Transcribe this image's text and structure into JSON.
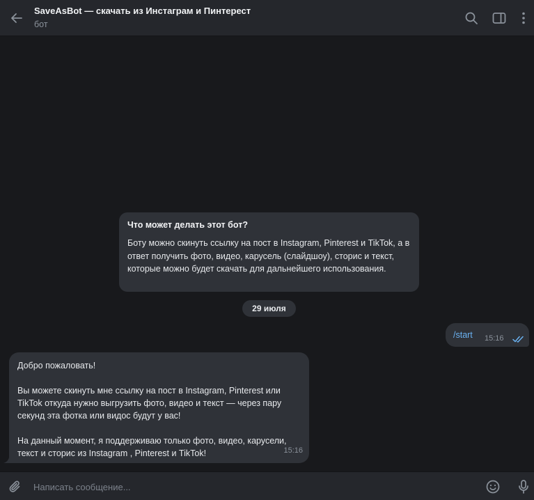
{
  "header": {
    "title": "SaveAsBot — скачать из Инстаграм и Пинтерест",
    "subtitle": "бот",
    "icons": [
      "back-arrow-icon",
      "search-icon",
      "sidebar-toggle-icon",
      "more-vertical-icon"
    ]
  },
  "intro_card": {
    "title": "Что может делать этот бот?",
    "text": "Боту можно скинуть ссылку на пост в Instagram, Pinterest и TikTok, а в ответ получить фото, видео, карусель (слайдшоу), сторис и текст, которые можно будет скачать для дальнейшего использования."
  },
  "date_separator": "29 июля",
  "outgoing_message": {
    "text": "/start",
    "time": "15:16",
    "status_icon": "double-check-icon"
  },
  "incoming_message": {
    "greeting": "Добро пожаловать!",
    "paragraph1": "Вы можете скинуть мне ссылку на пост в Instagram, Pinterest или TikTok откуда нужно выгрузить фото, видео и текст — через пару секунд эта фотка или видос будут у вас!",
    "paragraph2": "На данный момент, я поддерживаю только фото, видео, карусели, текст и сторис из Instagram , Pinterest и TikTok!",
    "time": "15:16"
  },
  "composer": {
    "placeholder": "Написать сообщение...",
    "value": "",
    "icons": [
      "paperclip-icon",
      "emoji-icon",
      "microphone-icon"
    ]
  },
  "colors": {
    "background": "#18191c",
    "header": "#25272c",
    "bubble": "#2f3238",
    "link": "#6ab2f2",
    "muted": "#8b929b",
    "check": "#6ab2f2"
  }
}
